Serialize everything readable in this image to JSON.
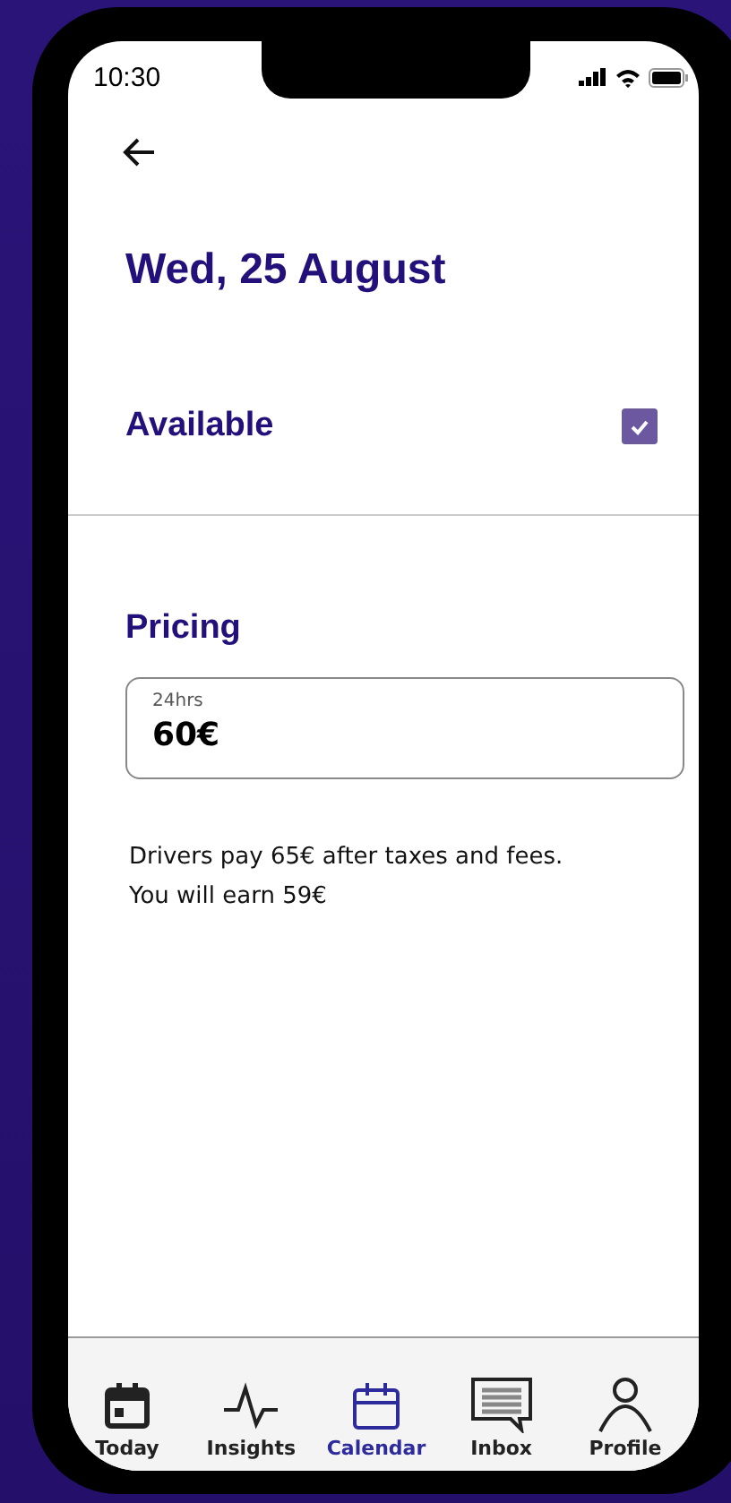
{
  "status_bar": {
    "time": "10:30"
  },
  "title": "Wed, 25 August",
  "availability": {
    "label": "Available",
    "checked": true
  },
  "pricing": {
    "heading": "Pricing",
    "field_label": "24hrs",
    "value": "60€"
  },
  "notes": [
    "Drivers pay 65€ after taxes and fees.",
    "You will earn 59€"
  ],
  "tabs": [
    {
      "kind": "today",
      "label": "Today",
      "selected": false
    },
    {
      "kind": "insights",
      "label": "Insights",
      "selected": false
    },
    {
      "kind": "calendar",
      "label": "Calendar",
      "selected": true
    },
    {
      "kind": "inbox",
      "label": "Inbox",
      "selected": false
    },
    {
      "kind": "profile",
      "label": "Profile",
      "selected": false
    }
  ]
}
